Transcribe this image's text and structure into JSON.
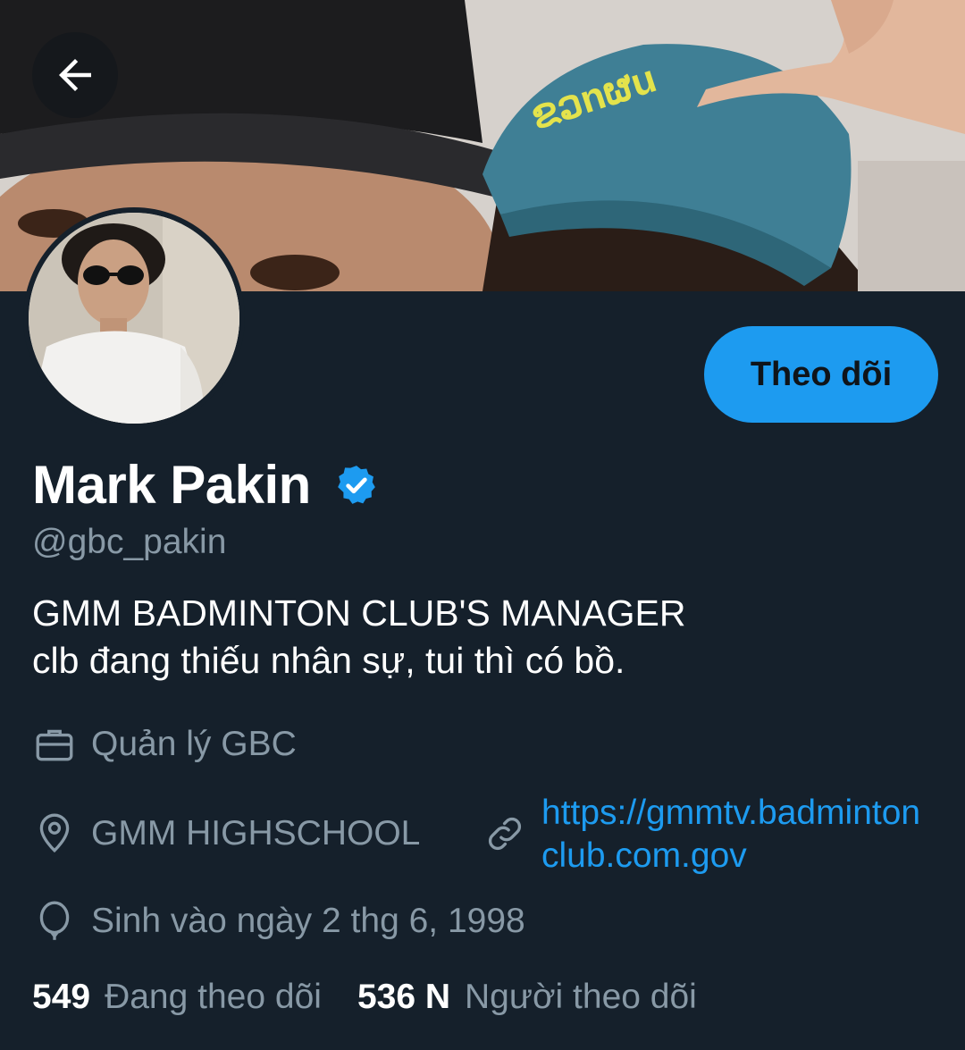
{
  "profile": {
    "display_name": "Mark Pakin",
    "handle": "@gbc_pakin",
    "bio_line1": "GMM BADMINTON CLUB'S MANAGER",
    "bio_line2": "clb đang thiếu nhân sự, tui thì có bồ.",
    "verified": true
  },
  "actions": {
    "follow_label": "Theo dõi"
  },
  "meta": {
    "job": "Quản lý GBC",
    "location": "GMM HIGHSCHOOL",
    "website": "https://gmmtv.badmintonclub.com.gov",
    "birthday": "Sinh vào ngày 2 thg 6, 1998"
  },
  "stats": {
    "following_count": "549",
    "following_label": "Đang theo dõi",
    "followers_count": "536 N",
    "followers_label": "Người theo dõi"
  },
  "colors": {
    "background": "#15202b",
    "accent": "#1d9bf0",
    "secondary_text": "#8899a6"
  },
  "icons": [
    "arrow-left-icon",
    "verified-badge-icon",
    "briefcase-icon",
    "location-pin-icon",
    "link-icon",
    "balloon-icon"
  ]
}
